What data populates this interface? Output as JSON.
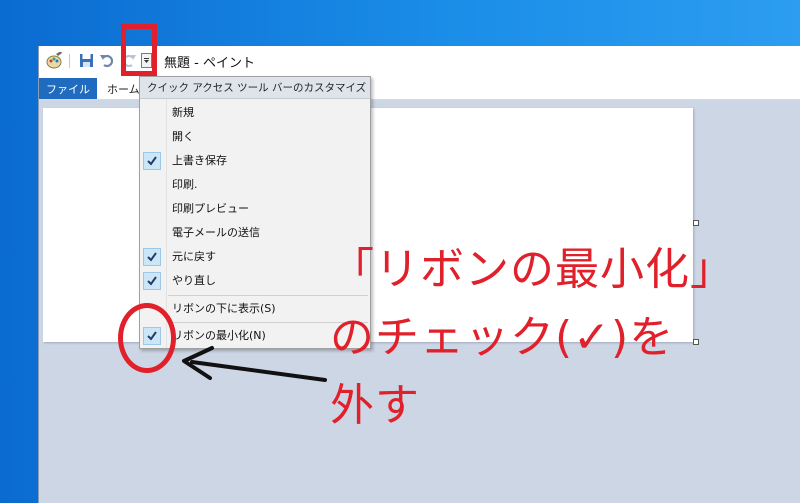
{
  "window": {
    "title": "無題 - ペイント"
  },
  "ribbon": {
    "tab_file": "ファイル",
    "tab_home": "ホーム"
  },
  "qat_menu": {
    "header": "クイック アクセス ツール バーのカスタマイズ",
    "items": [
      {
        "label": "新規",
        "checked": false
      },
      {
        "label": "開く",
        "checked": false
      },
      {
        "label": "上書き保存",
        "checked": true
      },
      {
        "label": "印刷.",
        "checked": false
      },
      {
        "label": "印刷プレビュー",
        "checked": false
      },
      {
        "label": "電子メールの送信",
        "checked": false
      },
      {
        "label": "元に戻す",
        "checked": true
      },
      {
        "label": "やり直し",
        "checked": true
      },
      {
        "label": "リボンの下に表示(S)",
        "checked": false
      },
      {
        "label": "リボンの最小化(N)",
        "checked": true
      }
    ]
  },
  "annotation": {
    "line1": "「リボンの最小化」",
    "line2": "のチェック(✓)を",
    "line3": "外す",
    "color": "#e0202a"
  },
  "icons": {
    "app": "paint-app-icon",
    "save": "save-icon",
    "undo": "undo-icon",
    "redo": "redo-icon",
    "dropdown": "chevron-down-icon",
    "check": "checkmark-icon"
  }
}
